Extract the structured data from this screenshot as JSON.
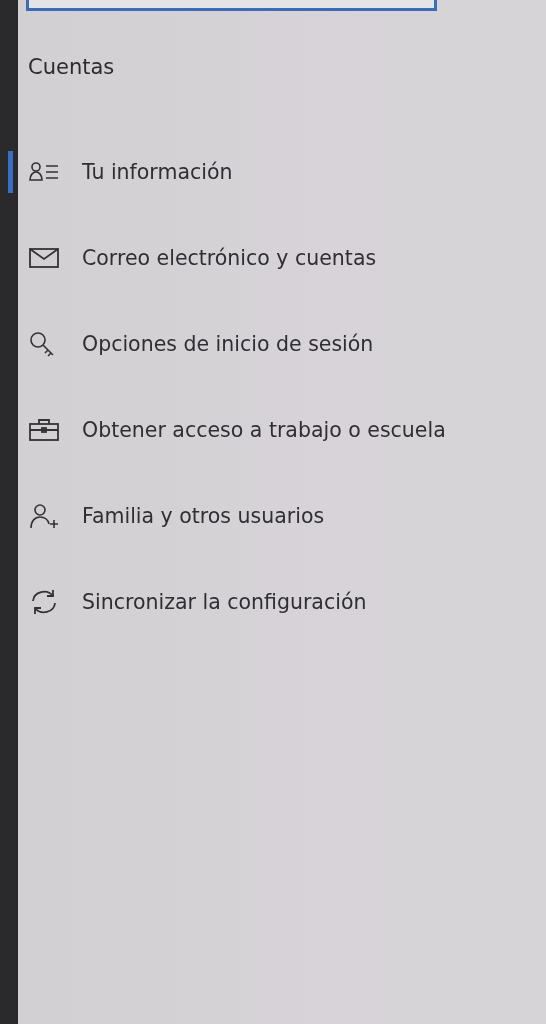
{
  "section_title": "Cuentas",
  "nav_items": [
    {
      "label": "Tu información",
      "selected": true
    },
    {
      "label": "Correo electrónico y cuentas",
      "selected": false
    },
    {
      "label": "Opciones de inicio de sesión",
      "selected": false
    },
    {
      "label": "Obtener acceso a trabajo o escuela",
      "selected": false
    },
    {
      "label": "Familia y otros usuarios",
      "selected": false
    },
    {
      "label": "Sincronizar la configuración",
      "selected": false
    }
  ]
}
